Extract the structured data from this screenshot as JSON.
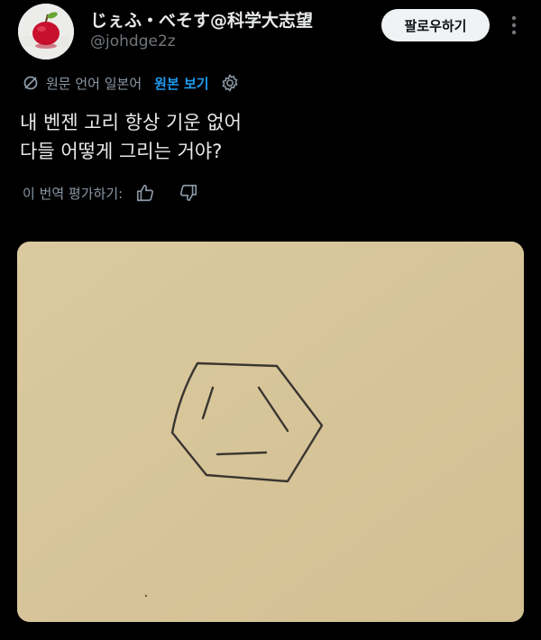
{
  "author": {
    "display_name": "じぇふ・べそす@科学大志望",
    "handle": "@johdge2z",
    "avatar_icon": "apple-icon"
  },
  "follow_label": "팔로우하기",
  "more_icon": "more-vertical-icon",
  "translation": {
    "notice": "원문 언어 일본어",
    "show_original": "원본 보기",
    "settings_icon": "gear-icon"
  },
  "tweet": {
    "line1": "내 벤젠 고리 항상 기운 없어",
    "line2": "다들 어떻게 그리는 거야?"
  },
  "rating": {
    "label": "이 번역 평가하기:",
    "like_icon": "thumbs-up-icon",
    "dislike_icon": "thumbs-down-icon"
  },
  "media": {
    "description_icon": "benzene-sketch-image"
  },
  "colors": {
    "background": "#000000",
    "text": "#e7e9ea",
    "muted": "#8b98a5",
    "link": "#1d9bf0",
    "paper": "#d7c59b"
  }
}
